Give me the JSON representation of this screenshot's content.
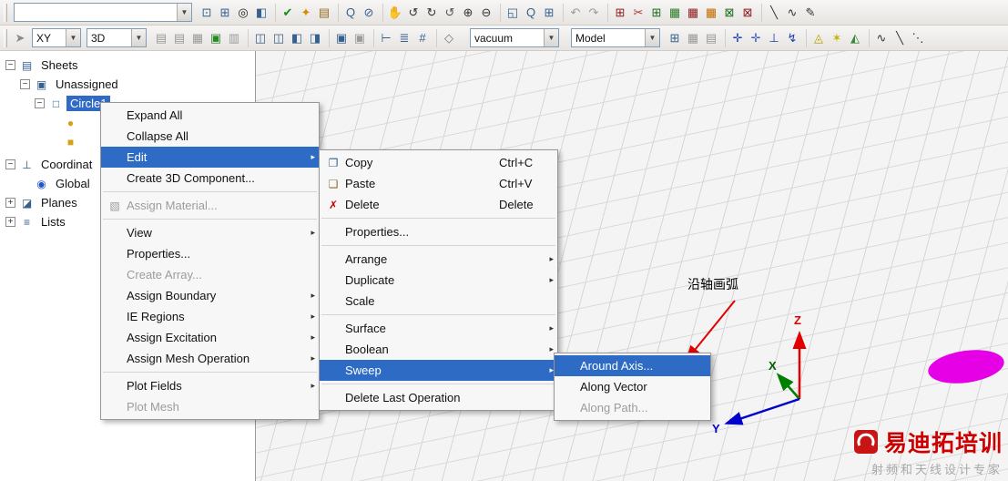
{
  "toolbars": {
    "row1_combo_value": "",
    "row1_groups": [
      {
        "icons": [
          {
            "name": "new-window-icon",
            "glyph": "⊡",
            "color": "#36618e"
          },
          {
            "name": "tile-windows-icon",
            "glyph": "⊞",
            "color": "#36618e"
          },
          {
            "name": "record-macro-icon",
            "glyph": "◎",
            "color": "#1a1a1a"
          },
          {
            "name": "cascade-windows-icon",
            "glyph": "◧",
            "color": "#36618e"
          }
        ]
      },
      {
        "icons": [
          {
            "name": "validate-check-icon",
            "glyph": "✔",
            "color": "#168a16"
          },
          {
            "name": "analyze-icon",
            "glyph": "✦",
            "color": "#d98a00"
          },
          {
            "name": "results-icon",
            "glyph": "▤",
            "color": "#9a6a1f"
          }
        ]
      },
      {
        "icons": [
          {
            "name": "zoom-doc-icon",
            "glyph": "Q",
            "color": "#36618e"
          },
          {
            "name": "no-symbol-icon",
            "glyph": "⊘",
            "color": "#36618e"
          }
        ]
      },
      {
        "icons": [
          {
            "name": "pan-hand-icon",
            "glyph": "✋",
            "color": "#333333"
          },
          {
            "name": "rotate-view-icon",
            "glyph": "↺",
            "color": "#333333"
          },
          {
            "name": "rotate-axis-icon",
            "glyph": "↻",
            "color": "#333333"
          },
          {
            "name": "spin-view-icon",
            "glyph": "↺",
            "color": "#555555"
          },
          {
            "name": "zoom-in-icon",
            "glyph": "⊕",
            "color": "#333333"
          },
          {
            "name": "zoom-out-icon",
            "glyph": "⊖",
            "color": "#333333"
          }
        ]
      },
      {
        "icons": [
          {
            "name": "zoom-window-icon",
            "glyph": "◱",
            "color": "#36618e"
          },
          {
            "name": "zoom-selection-icon",
            "glyph": "Q",
            "color": "#36618e"
          },
          {
            "name": "fit-all-icon",
            "glyph": "⊞",
            "color": "#36618e"
          }
        ]
      },
      {
        "icons": [
          {
            "name": "undo-icon",
            "glyph": "↶",
            "color": "#9a9a9a"
          },
          {
            "name": "redo-icon",
            "glyph": "↷",
            "color": "#9a9a9a"
          }
        ]
      },
      {
        "icons": [
          {
            "name": "boundary-display-icon",
            "glyph": "⊞",
            "color": "#8b1a1a"
          },
          {
            "name": "boundary-cut-icon",
            "glyph": "✂",
            "color": "#b03030"
          },
          {
            "name": "excitation-display-icon",
            "glyph": "⊞",
            "color": "#1a6b1a"
          },
          {
            "name": "mesh-display-icon",
            "glyph": "▦",
            "color": "#2a7a2a"
          },
          {
            "name": "mesh-refine-icon",
            "glyph": "▦",
            "color": "#8b1a1a"
          },
          {
            "name": "field-overlay-icon",
            "glyph": "▦",
            "color": "#c06a00"
          },
          {
            "name": "field-plot-icon",
            "glyph": "⊠",
            "color": "#1a6b1a"
          },
          {
            "name": "radiation-display-icon",
            "glyph": "⊠",
            "color": "#8b1a1a"
          }
        ]
      },
      {
        "icons": [
          {
            "name": "draw-line-icon",
            "glyph": "╲",
            "color": "#333333"
          },
          {
            "name": "draw-arc-icon",
            "glyph": "∿",
            "color": "#333333"
          },
          {
            "name": "draw-spline-icon",
            "glyph": "✎",
            "color": "#333333"
          }
        ]
      }
    ],
    "row2_lead": {
      "name": "pointer-mode-icon",
      "glyph": "➤",
      "color": "#8a8a8a"
    },
    "row2_plane_combo": "XY",
    "row2_view_combo": "3D",
    "row2_material_combo": "vacuum",
    "row2_model_combo": "Model",
    "row2_groups_a": [
      {
        "icons": [
          {
            "name": "boolean-unite-icon",
            "glyph": "▤",
            "color": "#9a9a9a"
          },
          {
            "name": "boolean-subtract-icon",
            "glyph": "▤",
            "color": "#9a9a9a"
          },
          {
            "name": "boolean-intersect-icon",
            "glyph": "▦",
            "color": "#9a9a9a"
          },
          {
            "name": "boolean-split-icon",
            "glyph": "▣",
            "color": "#2a8a2a"
          },
          {
            "name": "boolean-imprint-icon",
            "glyph": "▥",
            "color": "#9a9a9a"
          }
        ]
      },
      {
        "icons": [
          {
            "name": "align-horizontal-icon",
            "glyph": "◫",
            "color": "#36618e"
          },
          {
            "name": "align-vertical-icon",
            "glyph": "◫",
            "color": "#36618e"
          },
          {
            "name": "mirror-icon",
            "glyph": "◧",
            "color": "#36618e"
          },
          {
            "name": "offset-icon",
            "glyph": "◨",
            "color": "#36618e"
          }
        ]
      },
      {
        "icons": [
          {
            "name": "section-icon",
            "glyph": "▣",
            "color": "#36618e"
          },
          {
            "name": "connect-icon",
            "glyph": "▣",
            "color": "#9a9a9a"
          }
        ]
      },
      {
        "icons": [
          {
            "name": "measure-position-icon",
            "glyph": "⊢",
            "color": "#36618e"
          },
          {
            "name": "measure-length-icon",
            "glyph": "≣",
            "color": "#36618e"
          },
          {
            "name": "measure-area-icon",
            "glyph": "#",
            "color": "#36618e"
          }
        ]
      },
      {
        "icons": [
          {
            "name": "solid-box-icon",
            "glyph": "◇",
            "color": "#777777"
          }
        ]
      }
    ],
    "row2_groups_b": [
      {
        "icons": [
          {
            "name": "grid-settings-icon",
            "glyph": "⊞",
            "color": "#36618e"
          },
          {
            "name": "snap-mode-icon",
            "glyph": "▦",
            "color": "#9a9a9a"
          },
          {
            "name": "snap-plane-icon",
            "glyph": "▤",
            "color": "#9a9a9a"
          }
        ]
      },
      {
        "icons": [
          {
            "name": "cs-create-icon",
            "glyph": "✛",
            "color": "#1a3fb0"
          },
          {
            "name": "cs-face-icon",
            "glyph": "✛",
            "color": "#3a5fc0"
          },
          {
            "name": "cs-object-icon",
            "glyph": "⊥",
            "color": "#1a3fb0"
          },
          {
            "name": "cs-relative-icon",
            "glyph": "↯",
            "color": "#1a3fb0"
          }
        ]
      },
      {
        "icons": [
          {
            "name": "optimetrics-icon",
            "glyph": "◬",
            "color": "#b8a000"
          },
          {
            "name": "parametric-icon",
            "glyph": "✶",
            "color": "#c8b400"
          },
          {
            "name": "tuning-icon",
            "glyph": "◭",
            "color": "#3a8a3a"
          }
        ]
      },
      {
        "icons": [
          {
            "name": "curve-sine-icon",
            "glyph": "∿",
            "color": "#333333"
          },
          {
            "name": "curve-line-icon",
            "glyph": "╲",
            "color": "#333333"
          },
          {
            "name": "curve-dots-icon",
            "glyph": "⋱",
            "color": "#333333"
          }
        ]
      }
    ]
  },
  "tree": {
    "sheets": "Sheets",
    "unassigned": "Unassigned",
    "circle": "Circle1",
    "coordinate": "Coordinat",
    "global": "Global",
    "planes": "Planes",
    "lists": "Lists"
  },
  "menus": {
    "object": {
      "items": [
        {
          "label": "Expand All"
        },
        {
          "label": "Collapse All"
        },
        {
          "label": "Edit",
          "submenu": true,
          "highlighted": true
        },
        {
          "label": "Create 3D Component..."
        },
        {
          "sep": true
        },
        {
          "label": "Assign Material...",
          "disabled": true,
          "icon": {
            "name": "material-icon",
            "glyph": "▧",
            "color": "#9c9c9c"
          }
        },
        {
          "sep": true
        },
        {
          "label": "View",
          "submenu": true
        },
        {
          "label": "Properties..."
        },
        {
          "label": "Create Array...",
          "disabled": true
        },
        {
          "label": "Assign Boundary",
          "submenu": true
        },
        {
          "label": "IE Regions",
          "submenu": true
        },
        {
          "label": "Assign Excitation",
          "submenu": true
        },
        {
          "label": "Assign Mesh Operation",
          "submenu": true
        },
        {
          "sep": true
        },
        {
          "label": "Plot Fields",
          "submenu": true
        },
        {
          "label": "Plot Mesh",
          "disabled": true
        }
      ]
    },
    "edit": {
      "items": [
        {
          "label": "Copy",
          "shortcut": "Ctrl+C",
          "icon": {
            "name": "copy-icon",
            "glyph": "❐",
            "color": "#36618e"
          }
        },
        {
          "label": "Paste",
          "shortcut": "Ctrl+V",
          "icon": {
            "name": "paste-icon",
            "glyph": "❏",
            "color": "#8a6a2a"
          }
        },
        {
          "label": "Delete",
          "shortcut": "Delete",
          "icon": {
            "name": "delete-icon",
            "glyph": "✗",
            "color": "#c00000"
          }
        },
        {
          "sep": true
        },
        {
          "label": "Properties..."
        },
        {
          "sep": true
        },
        {
          "label": "Arrange",
          "submenu": true
        },
        {
          "label": "Duplicate",
          "submenu": true
        },
        {
          "label": "Scale"
        },
        {
          "sep": true
        },
        {
          "label": "Surface",
          "submenu": true
        },
        {
          "label": "Boolean",
          "submenu": true
        },
        {
          "label": "Sweep",
          "submenu": true,
          "highlighted": true
        },
        {
          "sep": true
        },
        {
          "label": "Delete Last Operation"
        }
      ]
    },
    "sweep": {
      "items": [
        {
          "label": "Around Axis...",
          "highlighted": true
        },
        {
          "label": "Along Vector"
        },
        {
          "label": "Along Path...",
          "disabled": true
        }
      ]
    }
  },
  "axes": {
    "x_label": "X",
    "y_label": "Y",
    "z_label": "Z"
  },
  "annotation": {
    "text": "沿轴画弧"
  },
  "watermark": {
    "title": "易迪拓培训",
    "subtitle": "射频和天线设计专家"
  },
  "colors": {
    "menu_highlight": "#2e6bc5",
    "tree_selection": "#316ac5",
    "ellipse_fill": "#e500e5",
    "axis_x": "#008000",
    "axis_y": "#0000cc",
    "axis_z": "#e00000",
    "annotation_arrow": "#e00000",
    "watermark_red": "#cc0000"
  }
}
